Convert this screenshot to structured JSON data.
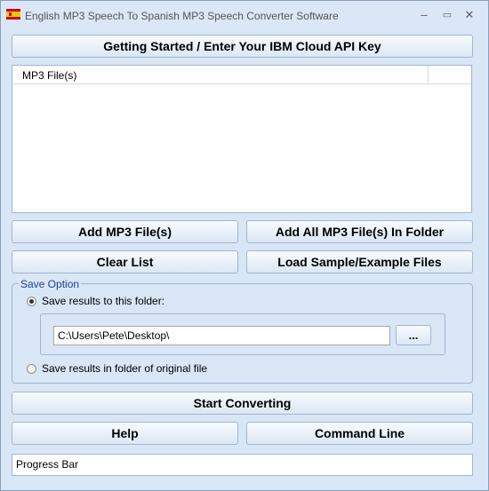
{
  "window": {
    "title": "English MP3 Speech To Spanish MP3 Speech Converter Software",
    "controls": {
      "minimize": "–",
      "maximize": "▭",
      "close": "✕"
    }
  },
  "buttons": {
    "getting_started": "Getting Started / Enter Your IBM Cloud API Key",
    "add_files": "Add MP3 File(s)",
    "add_folder": "Add All MP3 File(s) In Folder",
    "clear_list": "Clear List",
    "load_sample": "Load Sample/Example Files",
    "start": "Start Converting",
    "help": "Help",
    "command_line": "Command Line",
    "browse": "..."
  },
  "file_list": {
    "column_header": "MP3 File(s)"
  },
  "save_option": {
    "legend": "Save Option",
    "to_folder_label": "Save results to this folder:",
    "folder_path": "C:\\Users\\Pete\\Desktop\\",
    "original_folder_label": "Save results in folder of original file",
    "selected": "to_folder"
  },
  "progress": {
    "label": "Progress Bar"
  },
  "colors": {
    "window_bg": "#d9e6f5",
    "border": "#9fb6d2",
    "legend_text": "#1a3fa0"
  }
}
